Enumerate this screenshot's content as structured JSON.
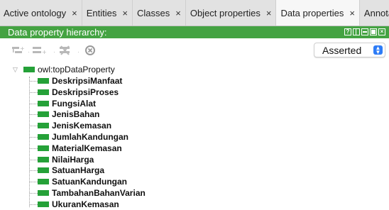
{
  "tabs": [
    {
      "label": "Active ontology",
      "close": "×",
      "active": false
    },
    {
      "label": "Entities",
      "close": "×",
      "active": false
    },
    {
      "label": "Classes",
      "close": "×",
      "active": false
    },
    {
      "label": "Object properties",
      "close": "×",
      "active": false
    },
    {
      "label": "Data properties",
      "close": "×",
      "active": true
    },
    {
      "label": "Annota",
      "close": "",
      "active": false
    }
  ],
  "view": {
    "title": "Data property hierarchy:",
    "header_buttons": [
      "help-icon",
      "split-icon",
      "minimize-icon",
      "maximize-icon",
      "close-icon"
    ]
  },
  "toolbar": {
    "icons": [
      "add-subproperty-icon",
      "add-sibling-property-icon",
      "delete-property-icon",
      "remove-icon"
    ],
    "mode_select": {
      "value": "Asserted"
    }
  },
  "tree": {
    "root": {
      "label": "owl:topDataProperty"
    },
    "children": [
      {
        "label": "DeskripsiManfaat"
      },
      {
        "label": "DeskripsiProses"
      },
      {
        "label": "FungsiAlat"
      },
      {
        "label": "JenisBahan"
      },
      {
        "label": "JenisKemasan"
      },
      {
        "label": "JumlahKandungan"
      },
      {
        "label": "MaterialKemasan"
      },
      {
        "label": "NilaiHarga"
      },
      {
        "label": "SatuanHarga"
      },
      {
        "label": "SatuanKandungan"
      },
      {
        "label": "TambahanBahanVarian"
      },
      {
        "label": "UkuranKemasan"
      }
    ]
  },
  "colors": {
    "header_green": "#44a342",
    "property_green": "#25a138",
    "select_arrow_blue": "#2e7cf6"
  }
}
